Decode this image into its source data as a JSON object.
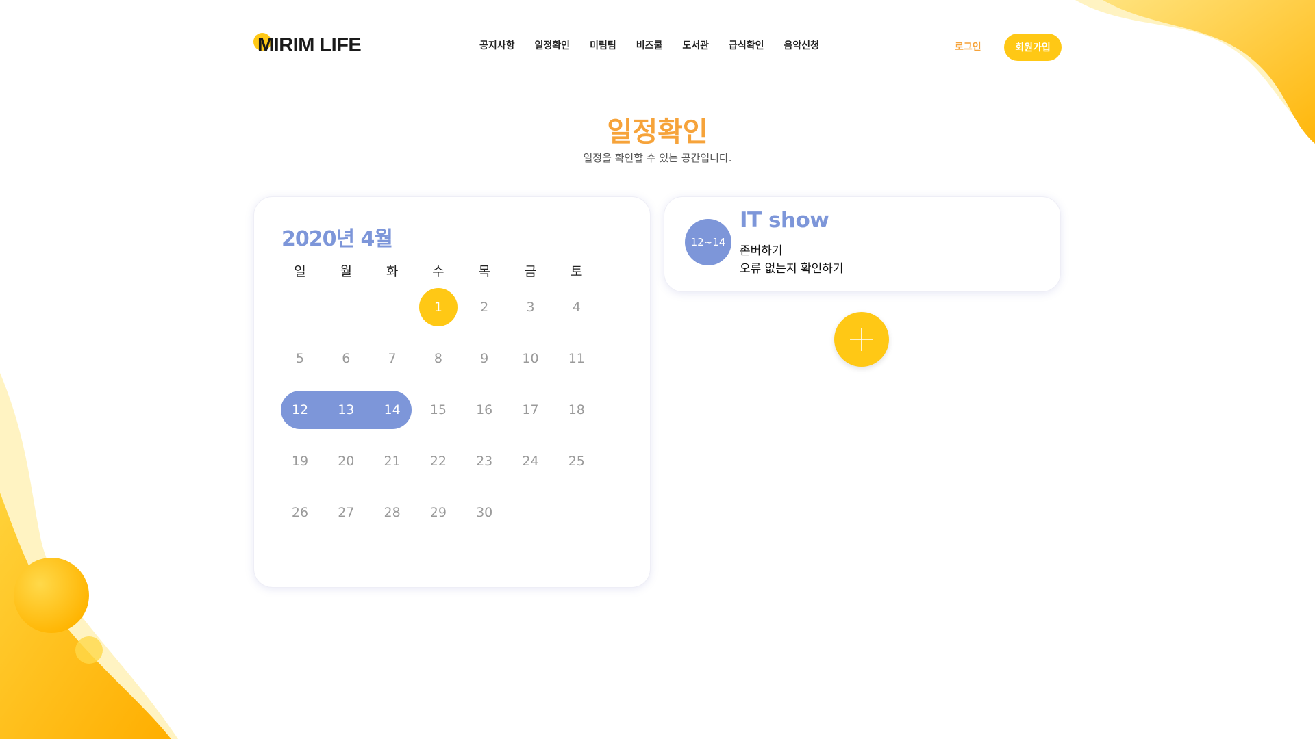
{
  "colors": {
    "accent_yellow": "#FFC815",
    "accent_orange": "#F6A33A",
    "accent_blue": "#7D96D9"
  },
  "header": {
    "logo": "MIRIM LIFE",
    "nav": [
      "공지사항",
      "일정확인",
      "미림팀",
      "비즈쿨",
      "도서관",
      "급식확인",
      "음악신청"
    ],
    "login_label": "로그인",
    "signup_label": "회원가입"
  },
  "page": {
    "title": "일정확인",
    "subtitle": "일정을 확인할 수 있는 공간입니다."
  },
  "calendar": {
    "title": "2020년 4월",
    "weekdays": [
      "일",
      "월",
      "화",
      "수",
      "목",
      "금",
      "토"
    ],
    "first_weekday_index": 3,
    "days_in_month": 30,
    "today": 1,
    "highlight_range": [
      12,
      14
    ]
  },
  "event": {
    "badge": "12~14",
    "title": "IT show",
    "lines": [
      "존버하기",
      "오류 없는지 확인하기"
    ]
  },
  "add_button": {
    "icon": "plus-icon"
  }
}
